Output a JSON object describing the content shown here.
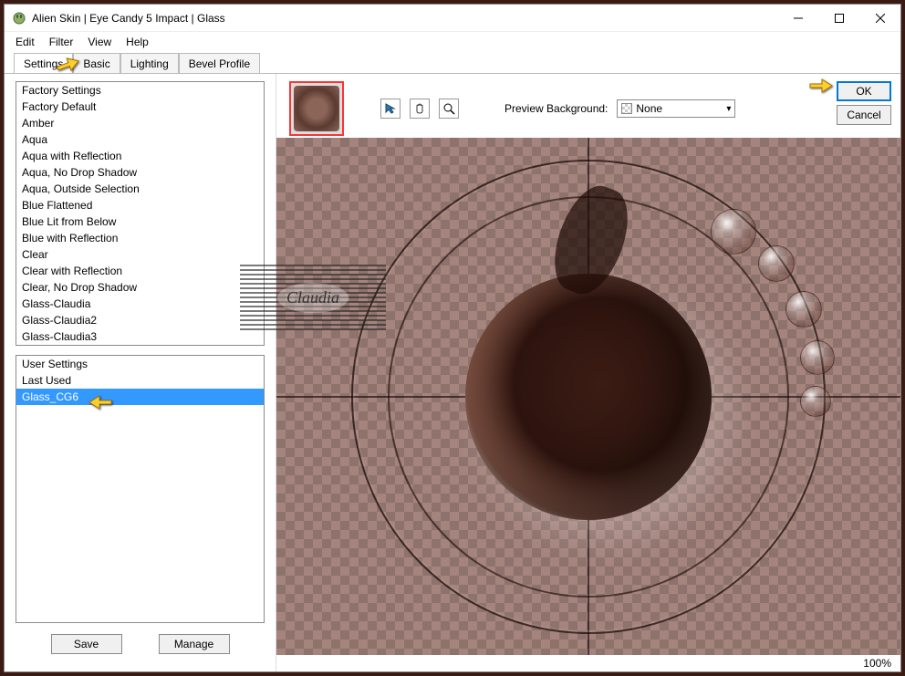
{
  "title": "Alien Skin | Eye Candy 5 Impact | Glass",
  "menu": {
    "edit": "Edit",
    "filter": "Filter",
    "view": "View",
    "help": "Help"
  },
  "tabs": {
    "settings": "Settings",
    "basic": "Basic",
    "lighting": "Lighting",
    "bevel": "Bevel Profile"
  },
  "factory": {
    "header": "Factory Settings",
    "items": [
      "Factory Default",
      "Amber",
      "Aqua",
      "Aqua with Reflection",
      "Aqua, No Drop Shadow",
      "Aqua, Outside Selection",
      "Blue Flattened",
      "Blue Lit from Below",
      "Blue with Reflection",
      "Clear",
      "Clear with Reflection",
      "Clear, No Drop Shadow",
      "Glass-Claudia",
      "Glass-Claudia2",
      "Glass-Claudia3"
    ]
  },
  "user": {
    "header": "User Settings",
    "items": [
      "Last Used",
      "Glass_CG6"
    ],
    "selected": "Glass_CG6"
  },
  "buttons": {
    "save": "Save",
    "manage": "Manage",
    "ok": "OK",
    "cancel": "Cancel"
  },
  "preview": {
    "label": "Preview Background:",
    "value": "None"
  },
  "zoom": "100%",
  "watermark": "Claudia"
}
